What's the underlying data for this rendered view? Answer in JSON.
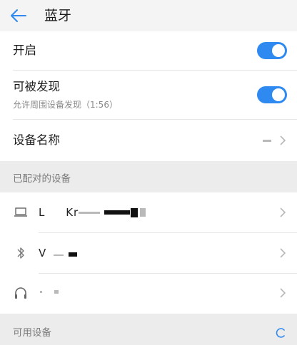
{
  "header": {
    "title": "蓝牙",
    "back_icon": "arrow-left-icon"
  },
  "bluetooth_switch": {
    "label": "开启",
    "state": "on"
  },
  "discoverable": {
    "label": "可被发现",
    "sub": "允许周围设备发现（1:56）",
    "state": "on"
  },
  "device_name": {
    "label": "设备名称",
    "value": ""
  },
  "paired_section": {
    "label": "已配对的设备"
  },
  "paired_devices": [
    {
      "icon": "laptop-icon",
      "name": "L     Kr"
    },
    {
      "icon": "bluetooth-icon",
      "name": "V"
    },
    {
      "icon": "headphones-icon",
      "name": ""
    }
  ],
  "available_section": {
    "label": "可用设备",
    "refresh_icon": "refresh-icon"
  },
  "colors": {
    "accent": "#2e89f0",
    "header_bg": "#f4f4f4",
    "section_bg": "#ececec"
  }
}
